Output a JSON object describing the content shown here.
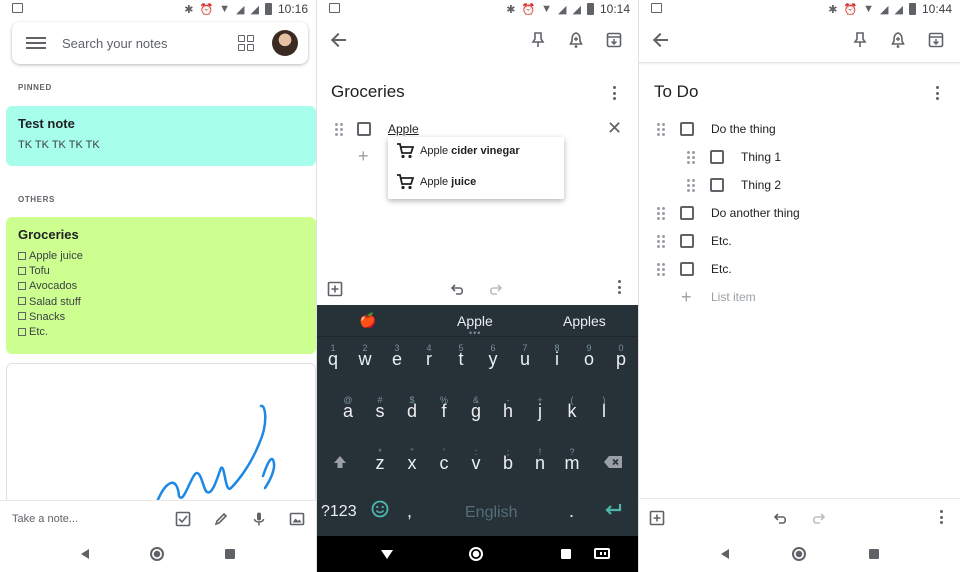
{
  "phone1": {
    "status_time": "10:16",
    "search": {
      "placeholder": "Search your notes"
    },
    "pinned_label": "PINNED",
    "others_label": "OTHERS",
    "pinned_note": {
      "title": "Test note",
      "body": "TK TK TK TK TK",
      "color": "#a7ffeb"
    },
    "groceries_note": {
      "title": "Groceries",
      "color": "#ccff90",
      "items": [
        "Apple juice",
        "Tofu",
        "Avocados",
        "Salad stuff",
        "Snacks",
        "Etc."
      ]
    },
    "take_note_placeholder": "Take a note..."
  },
  "phone2": {
    "status_time": "10:14",
    "title": "Groceries",
    "current_item": "Apple",
    "suggestions": [
      {
        "prefix": "Apple",
        "rest": "cider vinegar"
      },
      {
        "prefix": "Apple",
        "rest": "juice"
      }
    ],
    "keyboard": {
      "suggestions": [
        "🍎",
        "Apple",
        "Apples"
      ],
      "row1": [
        "q",
        "w",
        "e",
        "r",
        "t",
        "y",
        "u",
        "i",
        "o",
        "p"
      ],
      "row1_hints": [
        "1",
        "2",
        "3",
        "4",
        "5",
        "6",
        "7",
        "8",
        "9",
        "0"
      ],
      "row2": [
        "a",
        "s",
        "d",
        "f",
        "g",
        "h",
        "j",
        "k",
        "l"
      ],
      "row2_hints": [
        "@",
        "#",
        "$",
        "%",
        "&",
        "-",
        "+",
        "(",
        ")"
      ],
      "row3": [
        "z",
        "x",
        "c",
        "v",
        "b",
        "n",
        "m"
      ],
      "row3_hints": [
        "*",
        "\"",
        "'",
        ":",
        ";",
        "!",
        "?"
      ],
      "symbols_key": "?123",
      "comma": ",",
      "space_label": "English",
      "period": "."
    },
    "accent_color": "#4db6ac"
  },
  "phone3": {
    "status_time": "10:44",
    "title": "To Do",
    "items": [
      {
        "text": "Do the thing",
        "level": 0
      },
      {
        "text": "Thing 1",
        "level": 1
      },
      {
        "text": "Thing 2",
        "level": 1
      },
      {
        "text": "Do another thing",
        "level": 0
      },
      {
        "text": "Etc.",
        "level": 0
      },
      {
        "text": "Etc.",
        "level": 0
      }
    ],
    "add_item_placeholder": "List item"
  }
}
